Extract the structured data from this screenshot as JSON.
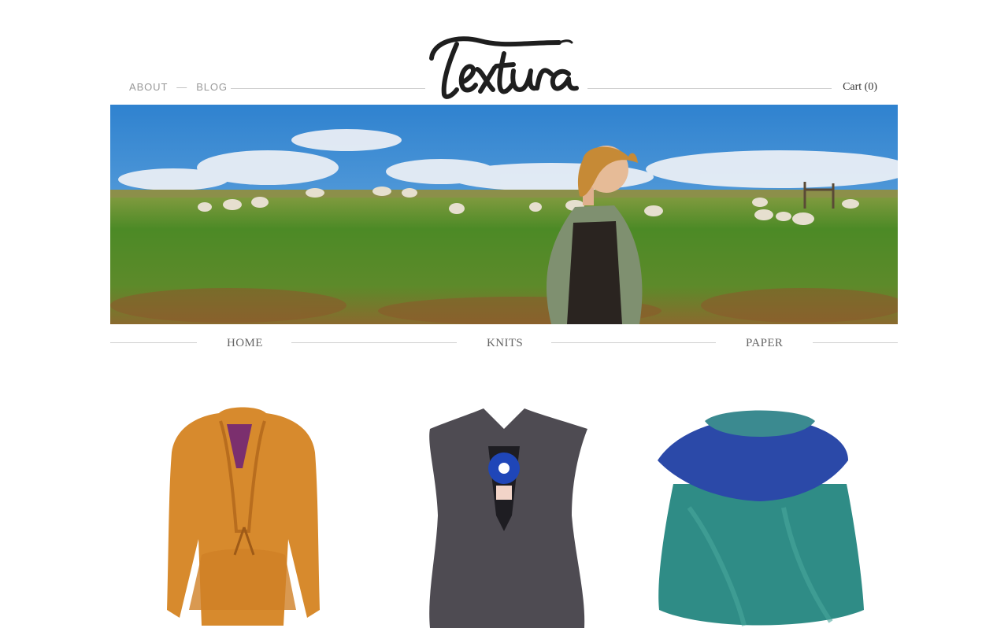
{
  "header": {
    "nav": [
      {
        "label": "ABOUT"
      },
      {
        "label": "BLOG"
      }
    ],
    "separator": "—",
    "logo_text": "Textura",
    "cart_label": "Cart",
    "cart_count": "(0)"
  },
  "hero": {
    "alt": "woman-in-green-cardigan-with-sheep-field"
  },
  "categories": [
    {
      "label": "HOME"
    },
    {
      "label": "KNITS"
    },
    {
      "label": "PAPER"
    }
  ],
  "products": [
    {
      "name": "mustard-cardigan",
      "color": "#d9892b"
    },
    {
      "name": "grey-vest",
      "color": "#4e4b52"
    },
    {
      "name": "teal-cape",
      "color": "#2f8c86"
    }
  ],
  "colors": {
    "sky": "#3b8fd6",
    "grass": "#4f8a2a",
    "rule": "#cfcfcf"
  }
}
